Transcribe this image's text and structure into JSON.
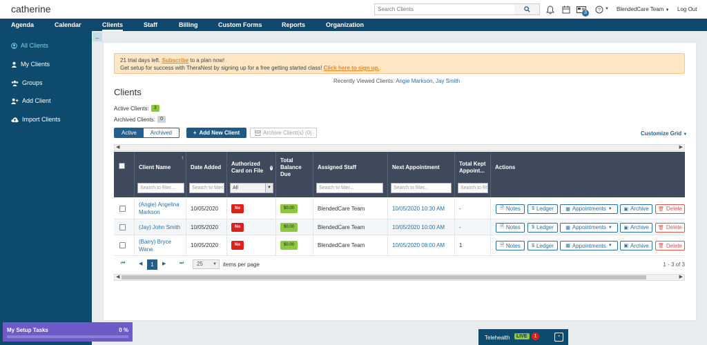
{
  "brand": "catherine",
  "search": {
    "placeholder": "Search Clients"
  },
  "topbar": {
    "message_count": "3",
    "user": "BlendedCare Team",
    "logout": "Log Out"
  },
  "nav": [
    "Agenda",
    "Calendar",
    "Clients",
    "Staff",
    "Billing",
    "Custom Forms",
    "Reports",
    "Organization"
  ],
  "sidebar": [
    "All Clients",
    "My Clients",
    "Groups",
    "Add Client",
    "Import Clients"
  ],
  "alert": {
    "line1_pre": "21 trial days left. ",
    "line1_link": "Subscribe",
    "line1_post": " to a plan now!",
    "line2_pre": "Get setup for success with TheraNest by signing up for a free getting started class! ",
    "line2_link": "Click here to sign up."
  },
  "recent": {
    "label": "Recently Viewed Clients:",
    "c1": "Angie Markson",
    "sep": ",",
    "c2": "Jay Smith"
  },
  "title": "Clients",
  "counts": {
    "active_label": "Active Clients:",
    "active": "3",
    "archived_label": "Archived Clients:",
    "archived": "0"
  },
  "toolbar": {
    "active": "Active",
    "archived": "Archived",
    "add": "Add New Client",
    "archive_selected": "Archive Client(s) (0)",
    "customize": "Customize Grid"
  },
  "columns": {
    "name": "Client Name",
    "date": "Date Added",
    "card": "Authorized Card on File",
    "balance": "Total Balance Due",
    "staff": "Assigned Staff",
    "appt": "Next Appointment",
    "kept": "Total Kept Appoint...",
    "actions": "Actions"
  },
  "filters": {
    "placeholder": "Search to filter...",
    "card_default": "All"
  },
  "rows": [
    {
      "name": "(Angie) Angelina Markson",
      "date": "10/05/2020",
      "card": "No",
      "balance": "$0.00",
      "staff": "BlendedCare Team",
      "appt": "10/05/2020 10:30 AM",
      "kept": "-"
    },
    {
      "name": "(Jay) John Smith",
      "date": "10/05/2020",
      "card": "No",
      "balance": "$0.00",
      "staff": "BlendedCare Team",
      "appt": "10/05/2020 10:00 AM",
      "kept": "-"
    },
    {
      "name": "(Barry) Bryce Wane",
      "date": "10/05/2020",
      "card": "No",
      "balance": "$0.00",
      "staff": "BlendedCare Team",
      "appt": "10/05/2020 08:00 AM",
      "kept": "1"
    }
  ],
  "row_actions": {
    "notes": "Notes",
    "ledger": "Ledger",
    "appointments": "Appointments",
    "archive": "Archive",
    "delete": "Delete"
  },
  "pager": {
    "page": "1",
    "size": "25",
    "label": "items per page",
    "range": "1 - 3 of 3"
  },
  "setup": {
    "title": "My Setup Tasks",
    "percent": "0 %",
    "progress": 0
  },
  "telehealth": {
    "label": "Telehealth",
    "live": "LIVE",
    "count": "1"
  },
  "colors": {
    "nav": "#0f4a6e",
    "accent": "#2a6fa3",
    "danger": "#d9231a",
    "success": "#8dc63f",
    "setup": "#6e5bc7"
  }
}
